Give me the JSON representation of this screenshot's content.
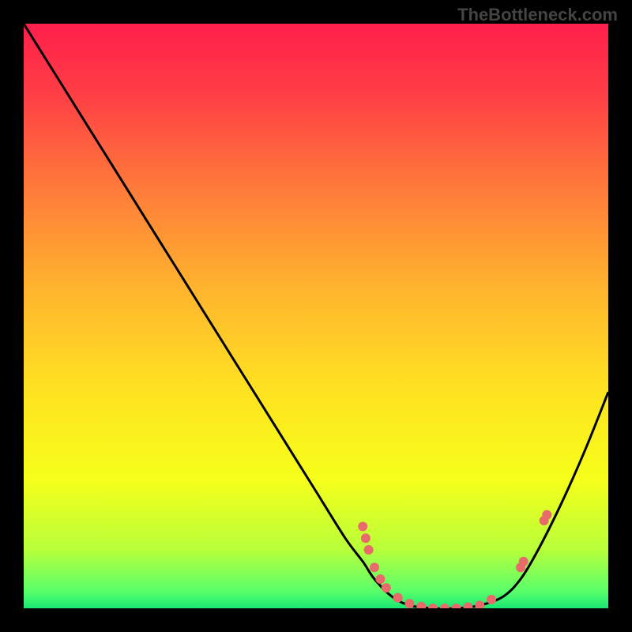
{
  "watermark": "TheBottleneck.com",
  "chart_data": {
    "type": "line",
    "title": "",
    "xlabel": "",
    "ylabel": "",
    "xlim": [
      0,
      100
    ],
    "ylim": [
      0,
      100
    ],
    "series": [
      {
        "name": "curve",
        "x": [
          0,
          5,
          10,
          15,
          20,
          25,
          30,
          35,
          40,
          45,
          50,
          55,
          58,
          60,
          63,
          66,
          70,
          74,
          78,
          82,
          85,
          88,
          92,
          96,
          100
        ],
        "y": [
          100,
          92,
          84,
          76,
          68,
          60,
          52,
          44,
          36,
          28,
          20,
          12,
          8,
          5,
          2,
          0.5,
          0,
          0,
          0.5,
          2,
          5,
          10,
          18,
          27,
          37
        ]
      }
    ],
    "markers": [
      {
        "x": 58,
        "y": 14
      },
      {
        "x": 58.5,
        "y": 12
      },
      {
        "x": 59,
        "y": 10
      },
      {
        "x": 60,
        "y": 7
      },
      {
        "x": 61,
        "y": 5
      },
      {
        "x": 62,
        "y": 3.5
      },
      {
        "x": 64,
        "y": 1.8
      },
      {
        "x": 66,
        "y": 0.8
      },
      {
        "x": 68,
        "y": 0.3
      },
      {
        "x": 70,
        "y": 0
      },
      {
        "x": 72,
        "y": 0
      },
      {
        "x": 74,
        "y": 0
      },
      {
        "x": 76,
        "y": 0.2
      },
      {
        "x": 78,
        "y": 0.5
      },
      {
        "x": 80,
        "y": 1.5
      },
      {
        "x": 85,
        "y": 7
      },
      {
        "x": 85.5,
        "y": 8
      },
      {
        "x": 89,
        "y": 15
      },
      {
        "x": 89.5,
        "y": 16
      }
    ],
    "gradient_stops": [
      {
        "offset": 0,
        "color": "#ff1f4b"
      },
      {
        "offset": 0.12,
        "color": "#ff3e45"
      },
      {
        "offset": 0.28,
        "color": "#ff7a3a"
      },
      {
        "offset": 0.45,
        "color": "#ffb32e"
      },
      {
        "offset": 0.62,
        "color": "#ffe121"
      },
      {
        "offset": 0.78,
        "color": "#f6ff1a"
      },
      {
        "offset": 0.9,
        "color": "#b8ff3a"
      },
      {
        "offset": 0.97,
        "color": "#5bff6a"
      },
      {
        "offset": 1.0,
        "color": "#18e873"
      }
    ],
    "marker_color": "#e86a6a",
    "curve_color": "#000000"
  }
}
